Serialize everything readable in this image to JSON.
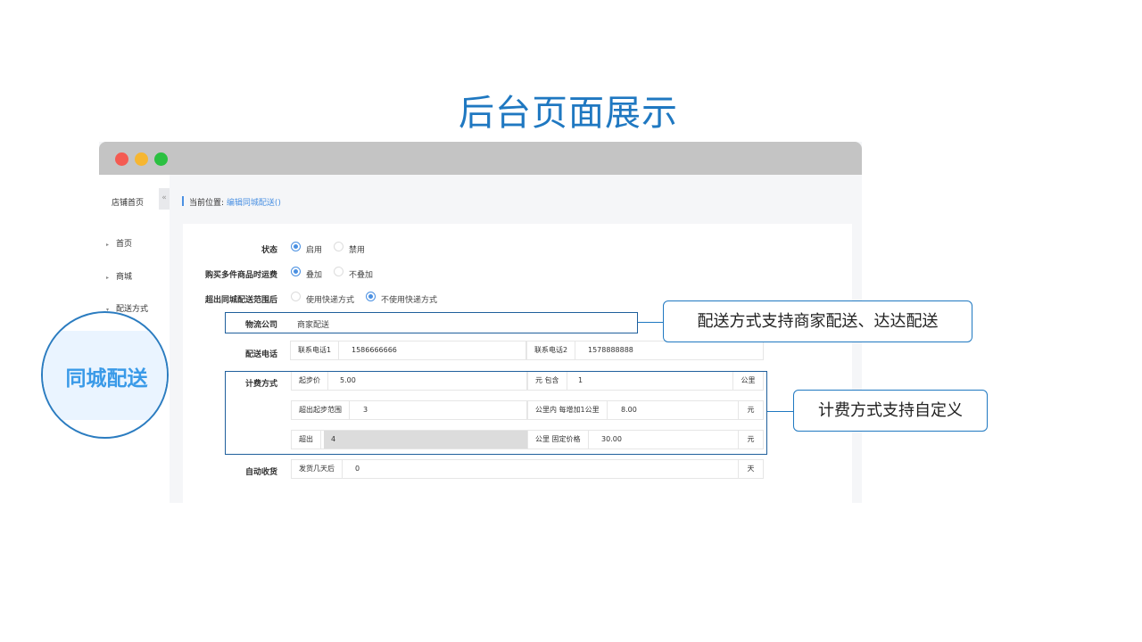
{
  "slide": {
    "title": "后台页面展示"
  },
  "sidebar": {
    "title": "店铺首页",
    "collapse_icon": "«",
    "items": [
      {
        "label": "首页",
        "arrow": "▸"
      },
      {
        "label": "商城",
        "arrow": "▸"
      },
      {
        "label": "配送方式",
        "arrow": "▾"
      }
    ]
  },
  "breadcrumb": {
    "prefix": "当前位置:",
    "current": "编辑同城配送()"
  },
  "form": {
    "status": {
      "label": "状态",
      "options": [
        "启用",
        "禁用"
      ],
      "selected": 0
    },
    "multi_fee": {
      "label": "购买多件商品时运费",
      "options": [
        "叠加",
        "不叠加"
      ],
      "selected": 0
    },
    "out_of_range": {
      "label": "超出同城配送范围后",
      "options": [
        "使用快递方式",
        "不使用快递方式"
      ],
      "selected": 1
    },
    "logistics": {
      "label": "物流公司",
      "value": "商家配送"
    },
    "phone": {
      "label": "配送电话",
      "phone1_label": "联系电话1",
      "phone1": "1586666666",
      "phone2_label": "联系电话2",
      "phone2": "1578888888"
    },
    "billing": {
      "label": "计费方式",
      "start_price_label": "起步价",
      "start_price": "5.00",
      "include_label": "元 包含",
      "include_value": "1",
      "include_unit": "公里",
      "over_range_label": "超出起步范围",
      "over_range": "3",
      "per_km_label": "公里内 每增加1公里",
      "per_km": "8.00",
      "per_km_unit": "元",
      "exceed_label": "超出",
      "exceed": "4",
      "fixed_label": "公里 固定价格",
      "fixed": "30.00",
      "fixed_unit": "元"
    },
    "auto_receive": {
      "label": "自动收货",
      "cap": "发货几天后",
      "value": "0",
      "unit": "天"
    }
  },
  "callouts": {
    "delivery": "配送方式支持商家配送、达达配送",
    "billing": "计费方式支持自定义"
  },
  "magnifier": {
    "label": "同城配送"
  },
  "colors": {
    "accent": "#1f78c1",
    "radio": "#4a90e2"
  }
}
